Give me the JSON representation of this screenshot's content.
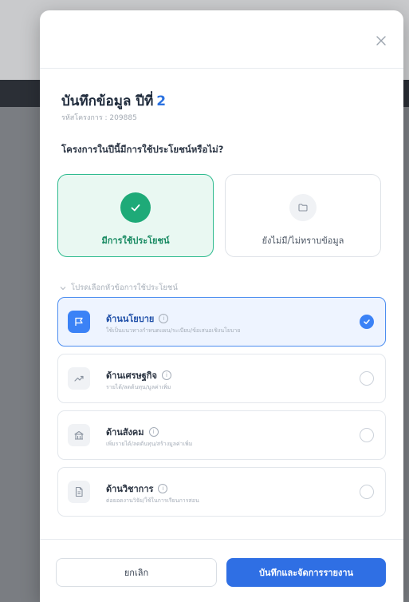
{
  "modal": {
    "title_prefix": "บันทึกข้อมูล ปีที่",
    "year_number": "2",
    "project_code": "รหัสโครงการ : 209885",
    "question": "โครงการในปีนี้มีการใช้ประโยชน์หรือไม่?"
  },
  "choices": [
    {
      "label": "มีการใช้ประโยชน์",
      "icon": "check-icon",
      "selected": true
    },
    {
      "label": "ยังไม่มี/ไม่ทราบข้อมูล",
      "icon": "folder-icon",
      "selected": false
    }
  ],
  "pick_label": "โปรดเลือกหัวข้อการใช้ประโยชน์",
  "options": [
    {
      "title": "ด้านนโยบาย",
      "desc": "ใช้เป็นแนวทางกำหนดแผน/ระเบียบ/ข้อเสนอเชิงนโยบาย",
      "icon": "flag-icon",
      "selected": true
    },
    {
      "title": "ด้านเศรษฐกิจ",
      "desc": "รายได้/ลดต้นทุน/มูลค่าเพิ่ม",
      "icon": "trend-up-icon",
      "selected": false
    },
    {
      "title": "ด้านสังคม",
      "desc": "เพิ่มรายได้/ลดต้นทุน/สร้างมูลค่าเพิ่ม",
      "icon": "building-icon",
      "selected": false
    },
    {
      "title": "ด้านวิชาการ",
      "desc": "ต่อยอดงานวิจัย/ใช้ในการเรียนการสอน",
      "icon": "document-icon",
      "selected": false
    }
  ],
  "footer": {
    "cancel": "ยกเลิก",
    "save": "บันทึกและจัดการรายงาน"
  },
  "colors": {
    "accent_blue": "#2f6fe4",
    "success_green": "#1eaa78"
  }
}
